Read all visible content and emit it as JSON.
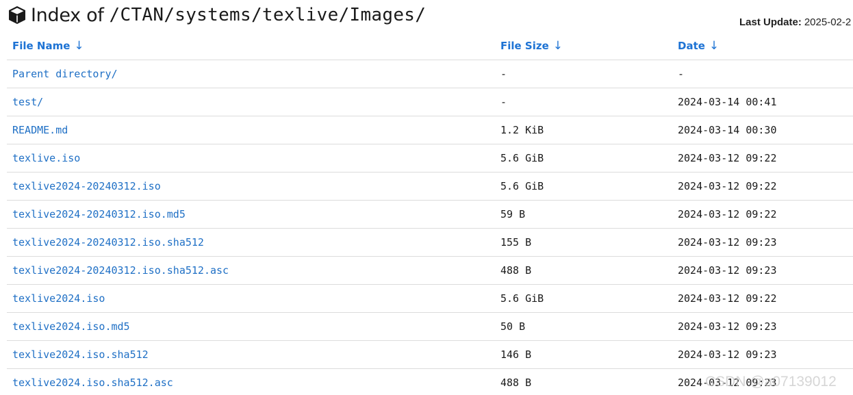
{
  "header": {
    "title_prefix": "Index of",
    "title_path": "/CTAN/systems/texlive/Images/",
    "icon": "cube-icon"
  },
  "last_update": {
    "label": "Last Update:",
    "value": "2025-02-2"
  },
  "columns": {
    "name": "File Name",
    "size": "File Size",
    "date": "Date",
    "sort_icon": "arrow-down-icon"
  },
  "rows": [
    {
      "name": "Parent directory/",
      "size": "-",
      "date": "-"
    },
    {
      "name": "test/",
      "size": "-",
      "date": "2024-03-14 00:41"
    },
    {
      "name": "README.md",
      "size": "1.2 KiB",
      "date": "2024-03-14 00:30"
    },
    {
      "name": "texlive.iso",
      "size": "5.6 GiB",
      "date": "2024-03-12 09:22"
    },
    {
      "name": "texlive2024-20240312.iso",
      "size": "5.6 GiB",
      "date": "2024-03-12 09:22"
    },
    {
      "name": "texlive2024-20240312.iso.md5",
      "size": "59 B",
      "date": "2024-03-12 09:22"
    },
    {
      "name": "texlive2024-20240312.iso.sha512",
      "size": "155 B",
      "date": "2024-03-12 09:23"
    },
    {
      "name": "texlive2024-20240312.iso.sha512.asc",
      "size": "488 B",
      "date": "2024-03-12 09:23"
    },
    {
      "name": "texlive2024.iso",
      "size": "5.6 GiB",
      "date": "2024-03-12 09:22"
    },
    {
      "name": "texlive2024.iso.md5",
      "size": "50 B",
      "date": "2024-03-12 09:23"
    },
    {
      "name": "texlive2024.iso.sha512",
      "size": "146 B",
      "date": "2024-03-12 09:23"
    },
    {
      "name": "texlive2024.iso.sha512.asc",
      "size": "488 B",
      "date": "2024-03-12 09:23"
    }
  ],
  "watermark": "CSDN @a07139012",
  "colors": {
    "link": "#1e6fc5",
    "header_link": "#1e73d4",
    "divider": "#dcdcdc"
  }
}
